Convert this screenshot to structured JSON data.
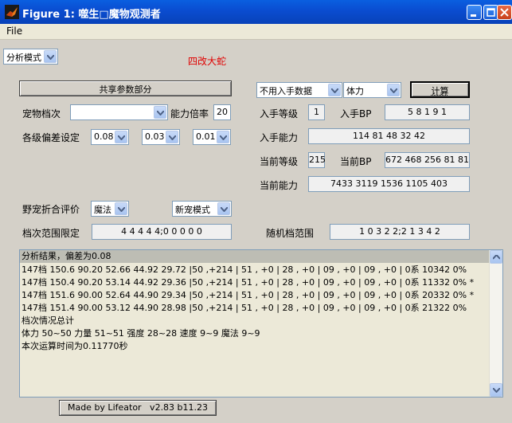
{
  "window": {
    "title": "Figure 1: 噬生□魔物观测者"
  },
  "menu": {
    "file_label": "File"
  },
  "top": {
    "mode_select": "分析模式",
    "pet_name": "四改大蛇",
    "pet_name_color": "#e00000"
  },
  "left": {
    "shared_button": "共享参数部分",
    "pet_tier_label": "宠物档次",
    "pet_tier_value": "",
    "ability_rate_label": "能力倍率",
    "ability_rate_value": "20",
    "deviation_label": "各级偏差设定",
    "dev1": "0.08",
    "dev2": "0.03",
    "dev3": "0.01"
  },
  "right": {
    "data_source": "不用入手数据",
    "stat_select": "体力",
    "calc_button": "计算",
    "obtain_level_label": "入手等级",
    "obtain_level_value": "1",
    "obtain_bp_label": "入手BP",
    "obtain_bp_value": "5 8 1 9 1",
    "obtain_ability_label": "入手能力",
    "obtain_ability_value": "114 81 48 32 42",
    "current_level_label": "当前等级",
    "current_level_value": "215",
    "current_bp_label": "当前BP",
    "current_bp_value": "672 468 256 81 81",
    "current_ability_label": "当前能力",
    "current_ability_value": "7433 3119 1536 1105 403"
  },
  "wild": {
    "eval_label": "野宠折合评价",
    "eval_select": "魔法",
    "mode_select": "新宠模式",
    "tier_range_label": "档次范围限定",
    "tier_range_value": "4 4 4 4 4;0 0 0 0 0",
    "random_range_label": "随机档范围",
    "random_range_value": "1 0 3 2 2;2 1 3 4 2"
  },
  "output": {
    "lines": [
      "分析结果，偏差为0.08",
      "147档 150.6 90.20 52.66 44.92 29.72 |50 ,+214 | 51 , +0 | 28 , +0 | 09 , +0 | 09 , +0 | 0系 10342  0%",
      "147档 150.4 90.20 53.14 44.92 29.36 |50 ,+214 | 51 , +0 | 28 , +0 | 09 , +0 | 09 , +0 | 0系 11332  0% *",
      "147档 151.6 90.00 52.64 44.90 29.34 |50 ,+214 | 51 , +0 | 28 , +0 | 09 , +0 | 09 , +0 | 0系 20332  0% *",
      "147档 151.4 90.00 53.12 44.90 28.98 |50 ,+214 | 51 , +0 | 28 , +0 | 09 , +0 | 09 , +0 | 0系 21322  0%",
      "档次情况总计",
      "体力 50~50 力量 51~51 强度 28~28 速度 9~9 魔法 9~9",
      "本次运算时间为0.11770秒"
    ]
  },
  "footer": {
    "credit": "Made by Lifeator   v2.83 b11.23"
  }
}
